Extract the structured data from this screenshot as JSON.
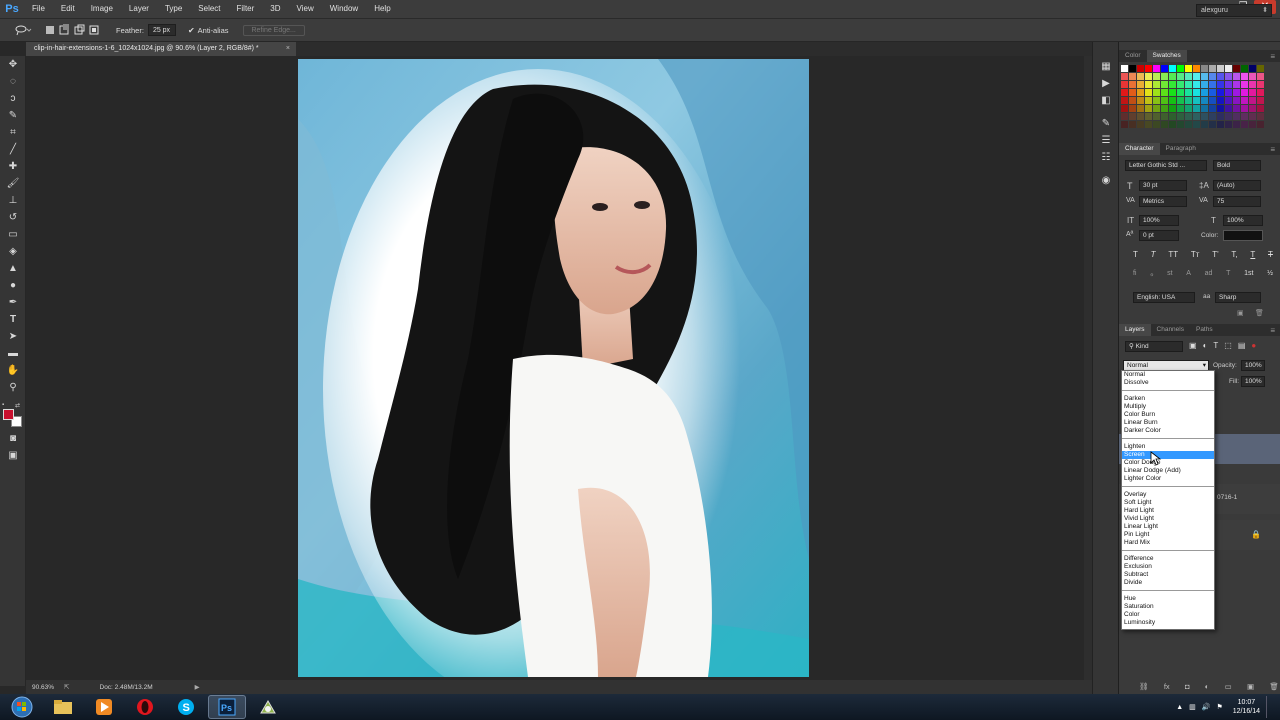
{
  "menubar": {
    "logo": "Ps",
    "items": [
      "File",
      "Edit",
      "Image",
      "Layer",
      "Type",
      "Select",
      "Filter",
      "3D",
      "View",
      "Window",
      "Help"
    ],
    "window_controls": [
      "▁",
      "❐",
      "✕"
    ]
  },
  "options": {
    "feather_label": "Feather:",
    "feather_value": "25 px",
    "antialias_label": "Anti-alias",
    "refine_edge_label": "Refine Edge...",
    "workspace": "alexguru"
  },
  "document": {
    "tab_title": "clip-in-hair-extensions-1-6_1024x1024.jpg @ 90.6% (Layer 2, RGB/8#) *",
    "close_glyph": "×"
  },
  "status": {
    "zoom": "90.63%",
    "doc_size": "Doc: 2.48M/13.2M"
  },
  "swatches_panel": {
    "tabs": [
      "Color",
      "Swatches"
    ],
    "active_tab": "Swatches"
  },
  "character_panel": {
    "tabs": [
      "Character",
      "Paragraph"
    ],
    "font_family": "Letter Gothic Std ...",
    "font_style": "Bold",
    "font_size": "30 pt",
    "leading": "(Auto)",
    "kerning": "Metrics",
    "tracking": "75",
    "vertical_scale": "100%",
    "horizontal_scale": "100%",
    "baseline_shift": "0 pt",
    "color_label": "Color:",
    "style_buttons": [
      "T",
      "T",
      "TT",
      "Tт",
      "T'",
      "T,",
      "T",
      "T"
    ],
    "opentype_buttons": [
      "ﬁ",
      "ℴ",
      "st",
      "A",
      "ad",
      "T",
      "1st",
      "½"
    ],
    "language": "English: USA",
    "aa_icon": "aa",
    "antialias": "Sharp"
  },
  "layers_panel": {
    "tabs": [
      "Layers",
      "Channels",
      "Paths"
    ],
    "filter_kind": "Kind",
    "blend_mode": "Normal",
    "opacity_label": "Opacity:",
    "opacity_value": "100%",
    "fill_label": "Fill:",
    "fill_value": "100%",
    "layer_name_fragment": "0716-1"
  },
  "blend_menu": {
    "groups": [
      [
        "Normal",
        "Dissolve"
      ],
      [
        "Darken",
        "Multiply",
        "Color Burn",
        "Linear Burn",
        "Darker Color"
      ],
      [
        "Lighten",
        "Screen",
        "Color Dodge",
        "Linear Dodge (Add)",
        "Lighter Color"
      ],
      [
        "Overlay",
        "Soft Light",
        "Hard Light",
        "Vivid Light",
        "Linear Light",
        "Pin Light",
        "Hard Mix"
      ],
      [
        "Difference",
        "Exclusion",
        "Subtract",
        "Divide"
      ],
      [
        "Hue",
        "Saturation",
        "Color",
        "Luminosity"
      ]
    ],
    "highlighted": "Screen"
  },
  "taskbar": {
    "apps": [
      "start-orb",
      "file-explorer",
      "media-player",
      "opera",
      "skype",
      "photoshop",
      "tool-app"
    ],
    "active_app": "photoshop",
    "time": "10:07",
    "date": "12/16/14"
  },
  "colors": {
    "foreground": "#c8102e",
    "background": "#ffffff",
    "highlight": "#3399ff",
    "ps_blue": "#4aa8ff"
  }
}
